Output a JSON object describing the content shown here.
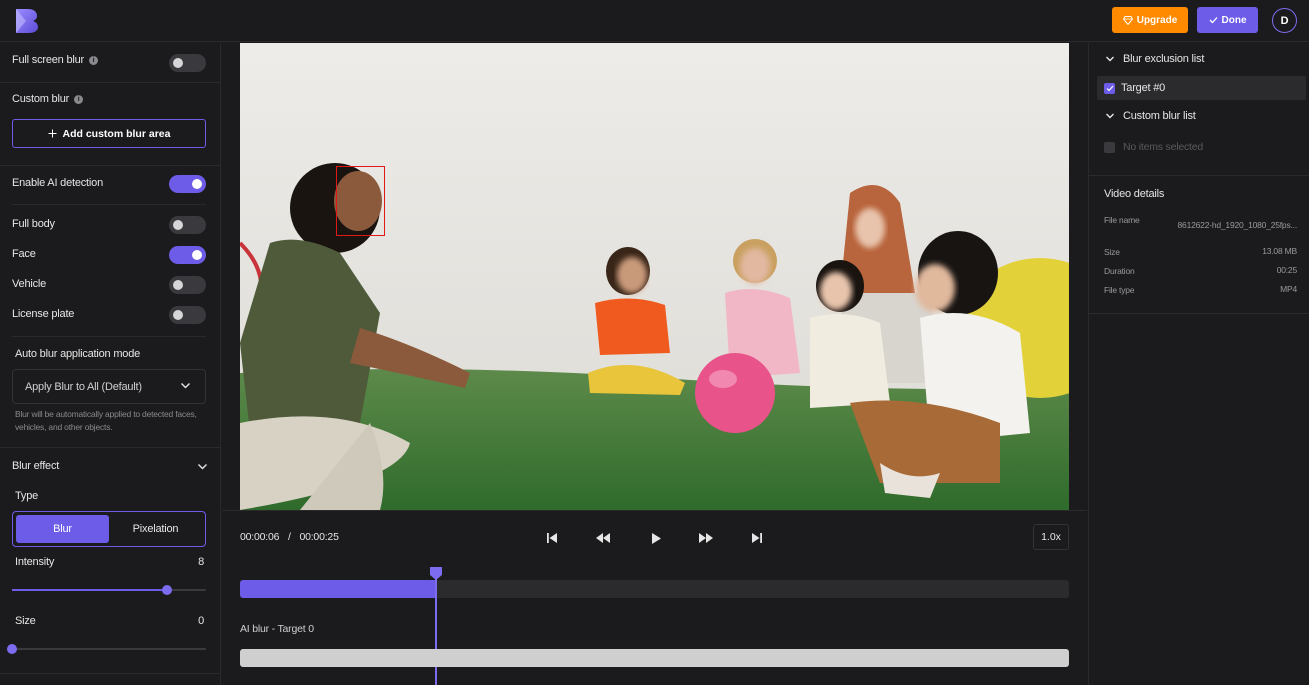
{
  "header": {
    "upgrade_label": "Upgrade",
    "done_label": "Done",
    "avatar_initial": "D"
  },
  "left_panel": {
    "full_screen_blur": {
      "label": "Full screen blur",
      "enabled": false
    },
    "custom_blur": {
      "label": "Custom blur",
      "add_button": "Add custom blur area"
    },
    "ai_detection": {
      "label": "Enable AI detection",
      "enabled": true
    },
    "detect_targets": [
      {
        "label": "Full body",
        "enabled": false
      },
      {
        "label": "Face",
        "enabled": true
      },
      {
        "label": "Vehicle",
        "enabled": false
      },
      {
        "label": "License plate",
        "enabled": false
      }
    ],
    "auto_blur_mode": {
      "label": "Auto blur application mode",
      "selected": "Apply Blur to All (Default)",
      "hint": "Blur will be automatically applied to detected faces, vehicles, and other objects."
    },
    "blur_effect": {
      "title": "Blur effect",
      "type_label": "Type",
      "types": [
        "Blur",
        "Pixelation"
      ],
      "selected_type": "Blur",
      "intensity": {
        "label": "Intensity",
        "value": 8,
        "max": 10
      },
      "size": {
        "label": "Size",
        "value": 0,
        "max": 10
      }
    }
  },
  "player": {
    "current_time": "00:00:06",
    "separator": "/",
    "duration": "00:00:25",
    "progress_fraction": 0.236,
    "speed": "1.0x",
    "track_label": "AI blur - Target 0"
  },
  "right_panel": {
    "exclusion_title": "Blur exclusion list",
    "exclusion_items": [
      {
        "label": "Target #0",
        "checked": true
      }
    ],
    "custom_list_title": "Custom blur list",
    "custom_empty": "No items selected",
    "video_details": {
      "title": "Video details",
      "file_name_label": "File name",
      "file_name": "8612622-hd_1920_1080_25fps...",
      "size_label": "Size",
      "size": "13.08 MB",
      "duration_label": "Duration",
      "duration": "00:25",
      "file_type_label": "File type",
      "file_type": "MP4"
    }
  },
  "colors": {
    "accent": "#6c5ce7",
    "upgrade": "#ff8a00",
    "detection_box": "#e01818"
  }
}
